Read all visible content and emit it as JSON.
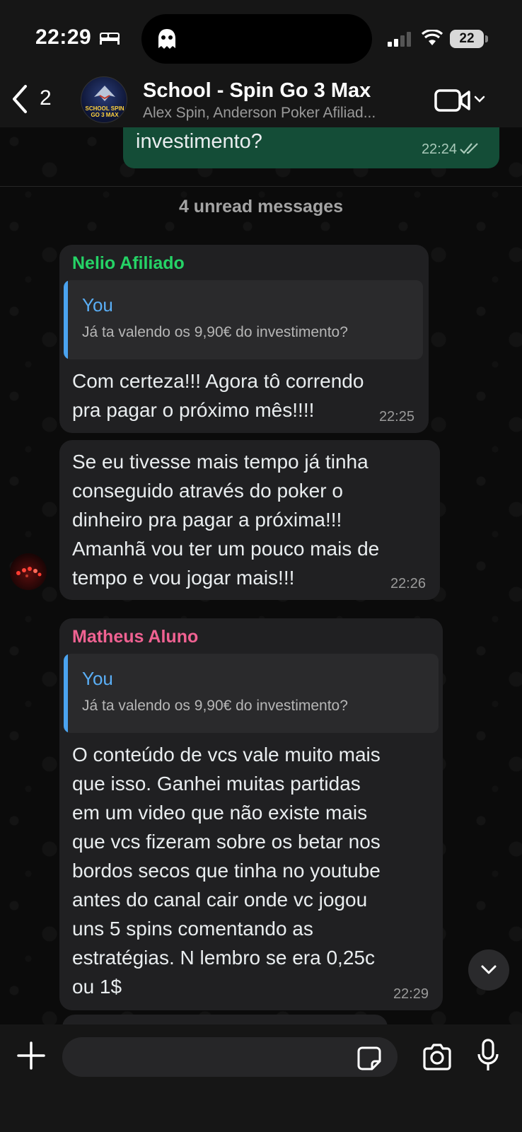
{
  "status_bar": {
    "time": "22:29",
    "battery": "22"
  },
  "header": {
    "back_count": "2",
    "avatar_text": "SCHOOL SPIN GO 3 MAX",
    "title": "School - Spin Go 3 Max",
    "members": "Alex Spin, Anderson Poker Afiliad..."
  },
  "outgoing": {
    "text": "investimento?",
    "time": "22:24"
  },
  "unread_label": "4 unread messages",
  "messages": [
    {
      "sender": "Nelio Afiliado",
      "sender_color": "#25d366",
      "quote_author": "You",
      "quote_text": "Já ta valendo os 9,90€ do investimento?",
      "lines": [
        "Com certeza!!! Agora tô correndo",
        "pra pagar o próximo mês!!!!"
      ],
      "time": "22:25"
    },
    {
      "lines": [
        "Se eu tivesse mais tempo já tinha",
        "conseguido através do poker o",
        "dinheiro pra pagar a próxima!!!",
        "Amanhã vou ter um pouco mais de",
        "tempo e vou jogar mais!!!"
      ],
      "time": "22:26"
    },
    {
      "sender": "Matheus Aluno",
      "sender_color": "#f06292",
      "quote_author": "You",
      "quote_text": "Já ta valendo os 9,90€ do investimento?",
      "lines": [
        "O conteúdo de vcs vale muito mais",
        "que isso. Ganhei muitas partidas",
        "em um video que não existe mais",
        "que vcs fizeram sobre os betar nos",
        "bordos secos que tinha no youtube",
        "antes do canal cair onde vc jogou",
        "uns 5 spins comentando as",
        "estratégias. N lembro se era 0,25c",
        "ou 1$"
      ],
      "time": "22:29"
    }
  ],
  "composer": {
    "input_value": ""
  },
  "colors": {
    "outgoing_bubble": "#144d37",
    "incoming_bubble": "#202022",
    "quote_accent": "#4aa3f0"
  }
}
